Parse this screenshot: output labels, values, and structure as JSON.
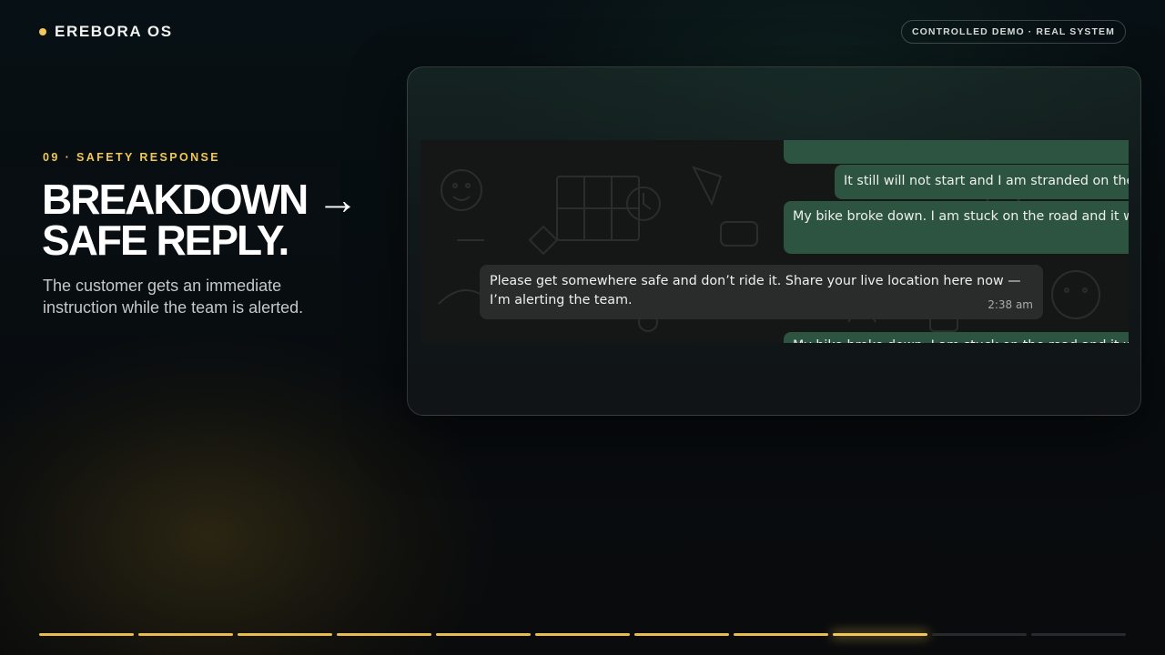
{
  "brand": {
    "name": "EREBORA OS"
  },
  "badge": {
    "label": "CONTROLLED DEMO · REAL SYSTEM"
  },
  "slide": {
    "kicker": "09 · SAFETY RESPONSE",
    "headline_line1": "BREAKDOWN →",
    "headline_line2": "SAFE REPLY.",
    "subtitle": "The customer gets an immediate instruction while the team is alerted."
  },
  "chat": {
    "messages": [
      {
        "direction": "outgoing",
        "text": ""
      },
      {
        "direction": "outgoing",
        "text": "It still will not start and I am stranded on the road"
      },
      {
        "direction": "outgoing",
        "text": "My bike broke down. I am stuck on the road and it will not start"
      },
      {
        "direction": "incoming",
        "text": "Please get somewhere safe and don’t ride it. Share your live location here now — I’m alerting the team.",
        "time": "2:38 am"
      },
      {
        "direction": "outgoing",
        "text": "My bike broke down. I am stuck on the road and it will not start"
      }
    ]
  },
  "progress": {
    "total": 11,
    "current": 9
  },
  "colors": {
    "accent": "#f0c85a",
    "outgoing_bubble": "#2c5440",
    "incoming_bubble": "#2a2b2b"
  }
}
